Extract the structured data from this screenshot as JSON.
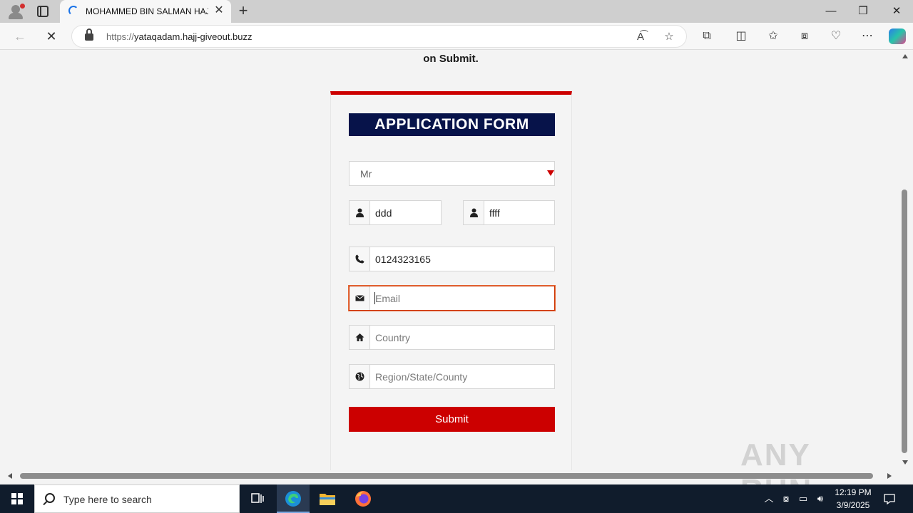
{
  "browser": {
    "tab_title": "MOHAMMED BIN SALMAN HAJJ",
    "url_protocol": "https://",
    "url_host": "yataqadam.hajj-giveout.buzz"
  },
  "page": {
    "lead_text": "on Submit.",
    "form": {
      "header": "APPLICATION FORM",
      "title_select": "Mr",
      "first_name": "ddd",
      "last_name": "ffff",
      "phone": "0124323165",
      "email_placeholder": "Email",
      "country_placeholder": "Country",
      "region_placeholder": "Region/State/County",
      "submit_label": "Submit"
    },
    "accent_color": "#cc0000",
    "header_color": "#07134a"
  },
  "watermark": "ANY RUN",
  "taskbar": {
    "search_placeholder": "Type here to search",
    "time": "12:19 PM",
    "date": "3/9/2025"
  }
}
